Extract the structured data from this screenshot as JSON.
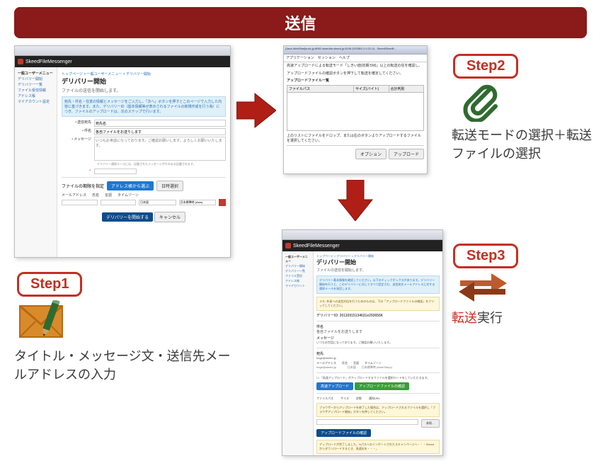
{
  "title": "送信",
  "steps": {
    "s1": {
      "label": "Step1",
      "desc": "タイトル・メッセージ文・送信先メールアドレスの入力"
    },
    "s2": {
      "label": "Step2",
      "desc": "転送モードの選択＋転送ファイルの選択"
    },
    "s3": {
      "label": "Step3",
      "desc_red": "転送",
      "desc_rest": "実行"
    }
  },
  "shot1": {
    "app_name": "SkeedFileMessenger",
    "breadcrumb": "トップページ > 一般ユーザーメニュー > デリバリー開始",
    "side_header": "一般ユーザーメニュー",
    "side_items": [
      "デリバリー開始",
      "デリバリー一覧",
      "ファイル受信情報",
      "アドレス帳",
      "マイアカウント設定"
    ],
    "h": "デリバリー開始",
    "sub": "ファイルの送信を開始します。",
    "notice": "宛先・件名・任意の情報とメッセージをご入力し、「次へ」ボタンを押すとこのページで入力した内容に基づきます。また、デリバリーID（基本情報等が表示されるファイルの新規作成を行う為）につき、ファイルのアップロードは、次のステップで行います。",
    "f_dest": "送信宛先",
    "f_dest_val": "宛先名",
    "f_subj": "件名",
    "f_subj_val": "各自ファイルをお送りします",
    "f_msg": "メッセージ",
    "msg_placeholder": "いつもお世話になっております。ご確認お願いします。よろしくお願いいたします。",
    "note_small": "デリバリー通知メールには、記載されたメッセージがそのまま記載されます。",
    "attach_label": "ファイルの期限を指定",
    "addr_btn": "アドレス帳から選ぶ",
    "pick_btn": "日時選択",
    "bar_labels": [
      "メールアドレス",
      "氏名",
      "言語",
      "タイムゾーン"
    ],
    "lang_val": "日本語",
    "tz_val": "日本標準時 (Asia)",
    "submit": "デリバリーを開始する",
    "cancel": "キャンセル"
  },
  "shot2": {
    "titlebar": "[Java WebStart]sock.jp:8080 skeedfm.skeed.jp:5106 (SSSBS-2.0.22.0) - SkeedSilverB...",
    "menu": "アプリケーション　セッション　ヘルプ",
    "desc1": "高速アップロードによる転送モード「しきい値(初期:5M)」以上の転送の信を確認し、",
    "desc2": "アップロードファイルの確認ボタンを押下して転送を確定してください。",
    "list_title": "アップロードファイル一覧",
    "cols": [
      "ファイルパス",
      "サイズ(バイト)",
      "合計判別"
    ],
    "hint": "上のリストにファイルをドロップ、または右のボタンよりアップロードするファイルを選択してください。",
    "btn_opt": "オプション",
    "btn_up": "アップロード"
  },
  "shot3": {
    "app_name": "SkeedFileMessenger",
    "side_header": "一般ユーザーメニュー",
    "side_items": [
      "デリバリー開始",
      "デリバリー一覧",
      "ファイル受信",
      "アドレス帳",
      "マイアカウント"
    ],
    "breadcrumb": "トップページ > デリバリー > デリバリー開始",
    "h": "デリバリー開始",
    "sub": "ファイルの送信を開始します。",
    "notice1": "デリバリー基本情報を確認してください。以下のチェックボックスがあります。デリバリー開始を行うと、このデリバリーに対してすべて設定され、送信宛先メールアドレスに対する通知メールを発信します。",
    "notice_y": "メモ: 外部への送信対応を行うためのものは、下の「アップロードファイルの確認」をクリックしてください。",
    "id_label": "デリバリーID:",
    "id_val": "20110915134631e293656K",
    "subj_label": "件名",
    "subj_val": "各自ファイルをお送りします",
    "msg_label": "メッセージ",
    "msg_val": "いつもお世話になっております。ご確認お願いいたします。",
    "dest_label": "宛先",
    "dest_val": "hoge@skeed.jp",
    "cols": [
      "メールアドレス",
      "氏名",
      "言語",
      "タイムゾーン"
    ],
    "col_vals": [
      "hoge@skeed.jp",
      "",
      "日本語",
      "日本標準時 (Asia/Tokyo)"
    ],
    "chk1": "「高速アップロード」がアップロードするファイルを選択ロードをしていただきます。",
    "btn_hi": "高速アップロード",
    "btn_ok1": "アップロードファイルの確認",
    "cols2": [
      "ファイルパス",
      "サイズ",
      "状態",
      "通知URL"
    ],
    "notice_y2": "ブラウザーからアップロードを終了した場合は、アップロードされるファイルを選択し「ブラウザアップロード開始」ボタンを押してください。",
    "btn_ok2": "アップロードファイルの確認",
    "notice_y3": "アップロードが完了しました。Nパスへのインポートされたスキャンページへ・・・Skeedからダウンロードするとき、高速化を・・・。"
  }
}
